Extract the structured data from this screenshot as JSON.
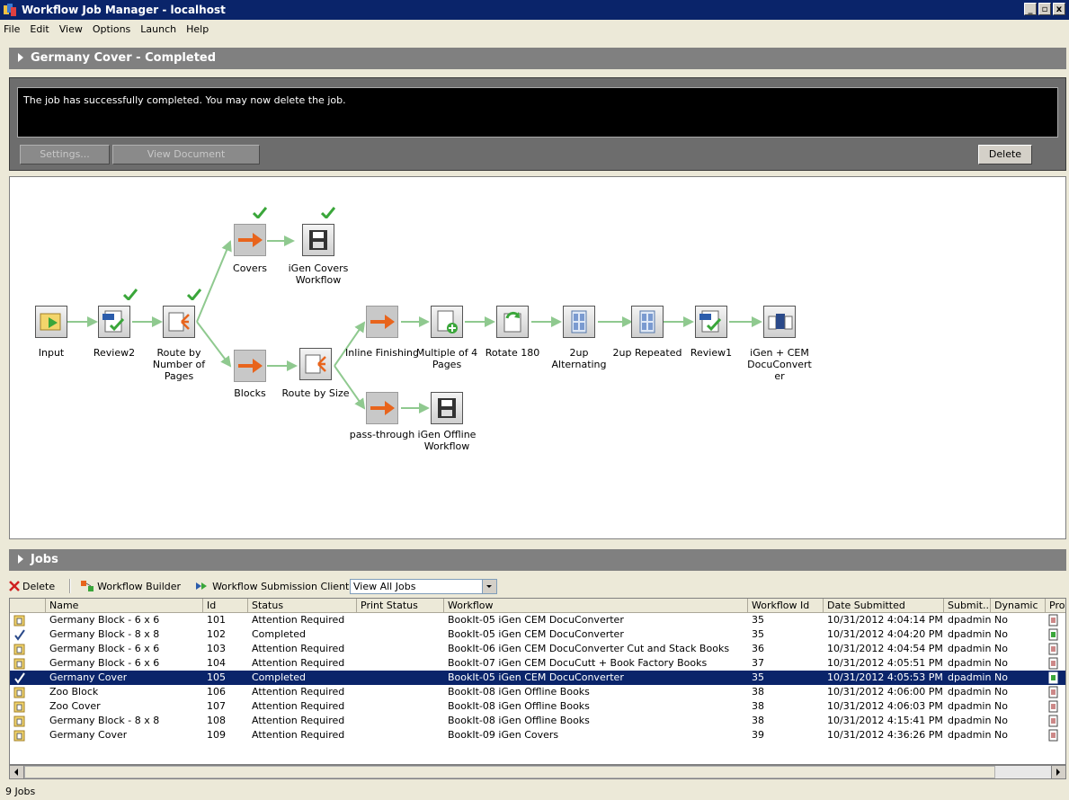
{
  "window": {
    "title": "Workflow Job Manager - localhost",
    "min": "_",
    "max": "▫",
    "close": "x"
  },
  "menu": [
    "File",
    "Edit",
    "View",
    "Options",
    "Launch",
    "Help"
  ],
  "job_header": {
    "title": "Germany Cover - Completed"
  },
  "job_panel": {
    "message": "The job has successfully completed.  You may now delete the job.",
    "settings_label": "Settings...",
    "view_document_label": "View Document",
    "delete_label": "Delete"
  },
  "workflow": {
    "nodes": {
      "input": "Input",
      "review2": "Review2",
      "route_pages": "Route by Number of Pages",
      "covers": "Covers",
      "igen_covers": "iGen Covers Workflow",
      "blocks": "Blocks",
      "route_size": "Route by Size",
      "inline": "Inline Finishing",
      "passthrough": "pass-through",
      "multiple4": "Multiple of 4 Pages",
      "igen_offline": "iGen Offline Workflow",
      "rotate": "Rotate 180",
      "alternating": "2up Alternating",
      "repeated": "2up Repeated",
      "review1": "Review1",
      "docuconverter": "iGen + CEM DocuConverter"
    }
  },
  "jobs_header": {
    "title": "Jobs"
  },
  "toolbar": {
    "delete_label": "Delete",
    "workflow_builder_label": "Workflow Builder",
    "submission_client_label": "Workflow Submission Client",
    "filter_value": "View All Jobs"
  },
  "columns": [
    "Name",
    "Id",
    "Status",
    "Print Status",
    "Workflow",
    "Workflow Id",
    "Date Submitted",
    "Submit...",
    "Dynamic",
    "Pro"
  ],
  "rows": [
    {
      "icon": "folder",
      "name": "Germany Block - 6 x 6",
      "id": "101",
      "status": "Attention Required",
      "print_status": "",
      "workflow": "BookIt-05 iGen CEM DocuConverter",
      "workflow_id": "35",
      "date": "10/31/2012 4:04:14 PM",
      "submitter": "dpadmin",
      "dynamic": "No"
    },
    {
      "icon": "check",
      "name": "Germany Block - 8 x 8",
      "id": "102",
      "status": "Completed",
      "print_status": "",
      "workflow": "BookIt-05 iGen CEM DocuConverter",
      "workflow_id": "35",
      "date": "10/31/2012 4:04:20 PM",
      "submitter": "dpadmin",
      "dynamic": "No"
    },
    {
      "icon": "folder",
      "name": "Germany Block - 6 x 6",
      "id": "103",
      "status": "Attention Required",
      "print_status": "",
      "workflow": "BookIt-06 iGen CEM DocuConverter Cut and Stack Books",
      "workflow_id": "36",
      "date": "10/31/2012 4:04:54 PM",
      "submitter": "dpadmin",
      "dynamic": "No"
    },
    {
      "icon": "folder",
      "name": "Germany Block - 6 x 6",
      "id": "104",
      "status": "Attention Required",
      "print_status": "",
      "workflow": "BookIt-07 iGen CEM DocuCutt + Book Factory Books",
      "workflow_id": "37",
      "date": "10/31/2012 4:05:51 PM",
      "submitter": "dpadmin",
      "dynamic": "No"
    },
    {
      "icon": "check",
      "name": "Germany Cover",
      "id": "105",
      "status": "Completed",
      "print_status": "",
      "workflow": "BookIt-05 iGen CEM DocuConverter",
      "workflow_id": "35",
      "date": "10/31/2012 4:05:53 PM",
      "submitter": "dpadmin",
      "dynamic": "No",
      "selected": true
    },
    {
      "icon": "folder",
      "name": "Zoo Block",
      "id": "106",
      "status": "Attention Required",
      "print_status": "",
      "workflow": "BookIt-08 iGen Offline Books",
      "workflow_id": "38",
      "date": "10/31/2012 4:06:00 PM",
      "submitter": "dpadmin",
      "dynamic": "No"
    },
    {
      "icon": "folder",
      "name": "Zoo Cover",
      "id": "107",
      "status": "Attention Required",
      "print_status": "",
      "workflow": "BookIt-08 iGen Offline Books",
      "workflow_id": "38",
      "date": "10/31/2012 4:06:03 PM",
      "submitter": "dpadmin",
      "dynamic": "No"
    },
    {
      "icon": "folder",
      "name": "Germany Block - 8 x 8",
      "id": "108",
      "status": "Attention Required",
      "print_status": "",
      "workflow": "BookIt-08 iGen Offline Books",
      "workflow_id": "38",
      "date": "10/31/2012 4:15:41 PM",
      "submitter": "dpadmin",
      "dynamic": "No"
    },
    {
      "icon": "folder",
      "name": "Germany Cover",
      "id": "109",
      "status": "Attention Required",
      "print_status": "",
      "workflow": "BookIt-09 iGen Covers",
      "workflow_id": "39",
      "date": "10/31/2012 4:36:26 PM",
      "submitter": "dpadmin",
      "dynamic": "No"
    }
  ],
  "status_bar": {
    "count": "9 Jobs"
  },
  "colors": {
    "titlebar": "#0a246a",
    "selection": "#0a246a",
    "section": "#808080",
    "arrow": "#e8641c",
    "check": "#3aa63a",
    "connector": "#8fc98f"
  }
}
